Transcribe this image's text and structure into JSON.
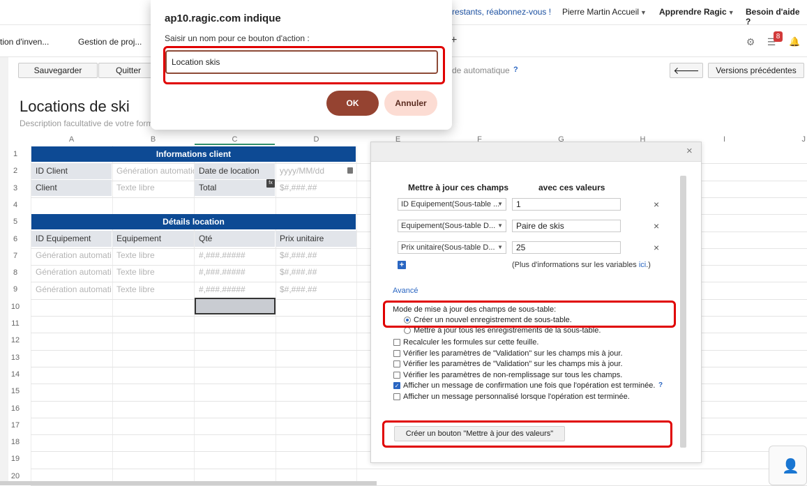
{
  "topbar": {
    "promo": "restants, réabonnez-vous !",
    "account": "Pierre Martin Accueil",
    "learn": "Apprendre Ragic",
    "help": "Besoin d'aide ?"
  },
  "menubar": {
    "tab1": "tion d'inven...",
    "tab2": "Gestion de proj...",
    "plus": "+",
    "badge_count": "8"
  },
  "toolbar": {
    "save": "Sauvegarder",
    "quit": "Quitter",
    "automatic": "de automatique",
    "help_q": "?",
    "back": "🡐",
    "versions": "Versions précédentes"
  },
  "form": {
    "title": "Locations de ski",
    "description": "Description facultative de votre form"
  },
  "sheet": {
    "columns": [
      "A",
      "B",
      "C",
      "D",
      "E",
      "F",
      "G",
      "H",
      "I",
      "J"
    ],
    "rows": [
      "1",
      "2",
      "3",
      "4",
      "5",
      "6",
      "7",
      "8",
      "9",
      "10",
      "11",
      "12",
      "13",
      "14",
      "15",
      "16",
      "17",
      "18",
      "19",
      "20"
    ],
    "section1": "Informations client",
    "section2": "Détails location",
    "client_id_label": "ID Client",
    "client_id_ph": "Génération automatiq",
    "date_label": "Date de location",
    "date_ph": "yyyy/MM/dd",
    "client_label": "Client",
    "client_ph": "Texte libre",
    "total_label": "Total",
    "total_ph": "$#,###.##",
    "fx": "fx",
    "detail_headers": [
      "ID Equipement",
      "Equipement",
      "Qté",
      "Prix unitaire"
    ],
    "detail_rows": [
      [
        "Génération automatiq",
        "Texte libre",
        "#,###.#####",
        "$#,###.##"
      ],
      [
        "Génération automatiq",
        "Texte libre",
        "#,###.#####",
        "$#,###.##"
      ],
      [
        "Génération automatiq",
        "Texte libre",
        "#,###.#####",
        "$#,###.##"
      ]
    ]
  },
  "panel": {
    "close": "×",
    "header_fields": "Mettre à jour ces champs",
    "header_values": "avec ces valeurs",
    "mappings": [
      {
        "field": "ID Equipement(Sous-table ...",
        "value": "1"
      },
      {
        "field": "Equipement(Sous-table D...",
        "value": "Paire de skis"
      },
      {
        "field": "Prix unitaire(Sous-table D...",
        "value": "25"
      }
    ],
    "delete": "×",
    "add": "+",
    "more_info_prefix": "(Plus d'informations sur les variables ",
    "more_info_link": "ici",
    "more_info_suffix": ".)",
    "advanced": "Avancé",
    "mode_label": "Mode de mise à jour des champs de sous-table:",
    "mode_create": "Créer un nouvel enregistrement de sous-table.",
    "mode_update_all": "Mettre à jour tous les enregistrements de la sous-table.",
    "options": [
      {
        "label": "Recalculer les formules sur cette feuille.",
        "checked": false
      },
      {
        "label": "Vérifier les paramètres de \"Validation\" sur les champs mis à jour.",
        "checked": false
      },
      {
        "label": "Vérifier les paramètres de \"Validation\" sur les champs mis à jour.",
        "checked": false
      },
      {
        "label": "Vérifier les paramètres de non-remplissage sur tous les champs.",
        "checked": false
      },
      {
        "label": "Afficher un message de confirmation une fois que l'opération est terminée.",
        "checked": true
      },
      {
        "label": "Afficher un message personnalisé lorsque l'opération est terminée.",
        "checked": false
      }
    ],
    "confirm_help": "?",
    "create_button": "Créer un bouton \"Mettre à jour des valeurs\""
  },
  "dialog": {
    "title": "ap10.ragic.com indique",
    "message": "Saisir un nom pour ce bouton d'action :",
    "input_value": "Location skis",
    "ok": "OK",
    "cancel": "Annuler"
  },
  "colors": {
    "section_bar": "#0d4a94",
    "ok_button": "#954331",
    "cancel_button": "#fcdcd3",
    "highlight": "#e00000",
    "link": "#2a66c2"
  }
}
